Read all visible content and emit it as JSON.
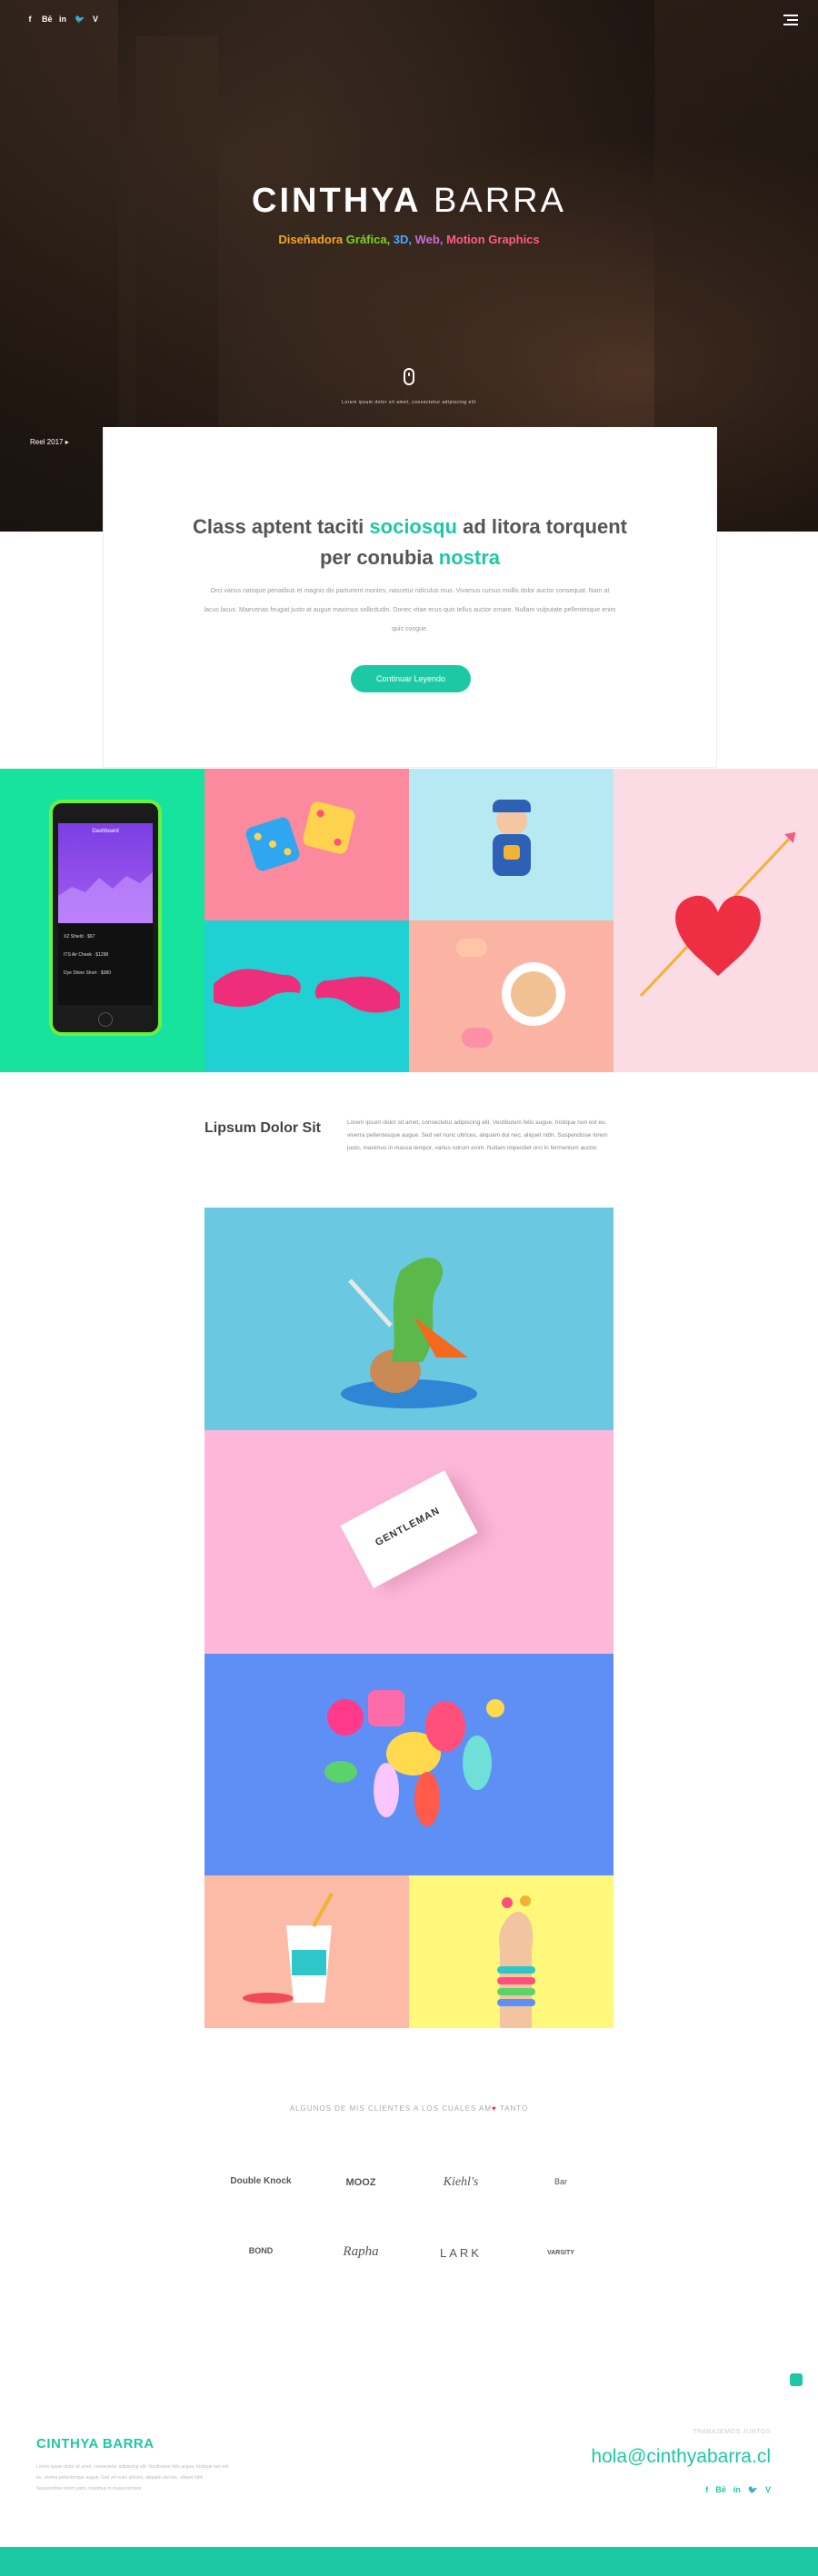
{
  "hero": {
    "social": [
      "f",
      "Bē",
      "in",
      "🐦",
      "V"
    ],
    "title_bold": "CINTHYA",
    "title_light": " BARRA",
    "subtitle": {
      "w1": "Diseñadora",
      "w2": " Gráfica,",
      "w3": " 3D,",
      "w4": " Web,",
      "w5": " Motion Graphics"
    },
    "caption": "Lorem ipsum dolor sit amet, consectetur adipiscing elit",
    "reel": "Reel 2017 ▸"
  },
  "intro": {
    "title_a": "Class aptent taciti ",
    "title_b": "sociosqu",
    "title_c": " ad litora torquent",
    "title_d": "per conubia ",
    "title_e": "nostra",
    "text": "Orci varius natoque penatibus et magnis dis parturient montes, nascetur ridiculus mus. Vivamus cursus mollis dolor auctor consequat. Nam at lacus lacus. Maecenas feugiat justo at augue maximus sollicitudin. Donec vitae ecus quis tellus auctor ornare. Nullam vulputate pellentesque enim quis congue.",
    "button": "Continuar Leyendo"
  },
  "phone": {
    "header": "Dashboard",
    "rows": [
      "XZ Shield  ·  $67",
      "ITS Air Cheek  ·  $1298",
      "Dye Shine Short  ·  $380"
    ]
  },
  "lipsum": {
    "title": "Lipsum Dolor Sit",
    "text": "Lorem ipsum dolor sit amet, consectetur adipiscing elit. Vestibulum felis augue, tristique non est eu, viverra pellentesque augue. Sed vel nunc ultrices, aliquam dui nec, aliquet nibh. Suspendisse lorem justo, maximus in massa tempor, varius rutrum enim. Nullam imperdiet orci in fermentum auctor."
  },
  "portfolio": {
    "card_brand": "GENTLEMAN"
  },
  "clients": {
    "title_a": "ALGUNOS DE MIS CLIENTES A LOS CUALES AM",
    "title_b": " TANTO",
    "logos": [
      "Double Knock",
      "MOOZ",
      "Kiehl's",
      "Bar",
      "BOND",
      "Rapha",
      "LARK",
      "VARSITY"
    ]
  },
  "footer": {
    "logo": "CINTHYA BARRA",
    "text": "Lorem ipsum dolor sit amet, consectetur adipiscing elit. Vestibulum felis augue, tristique non est eu, viverra pellentesque augue. Sed vel nunc ultrices, aliquam dui nec, aliquet nibh. Suspendisse lorem justo, maximus in massa tempor.",
    "label": "TRABAJEMOS JUNTOS",
    "email": "hola@cinthyabarra.cl",
    "social": [
      "f",
      "Bē",
      "in",
      "🐦",
      "V"
    ]
  },
  "colors": {
    "accent": "#1dc9a4",
    "pink": "#ff8fa3",
    "light_blue": "#b9e8f0",
    "blue": "#5e8ff5",
    "yellow": "#fff57a"
  }
}
